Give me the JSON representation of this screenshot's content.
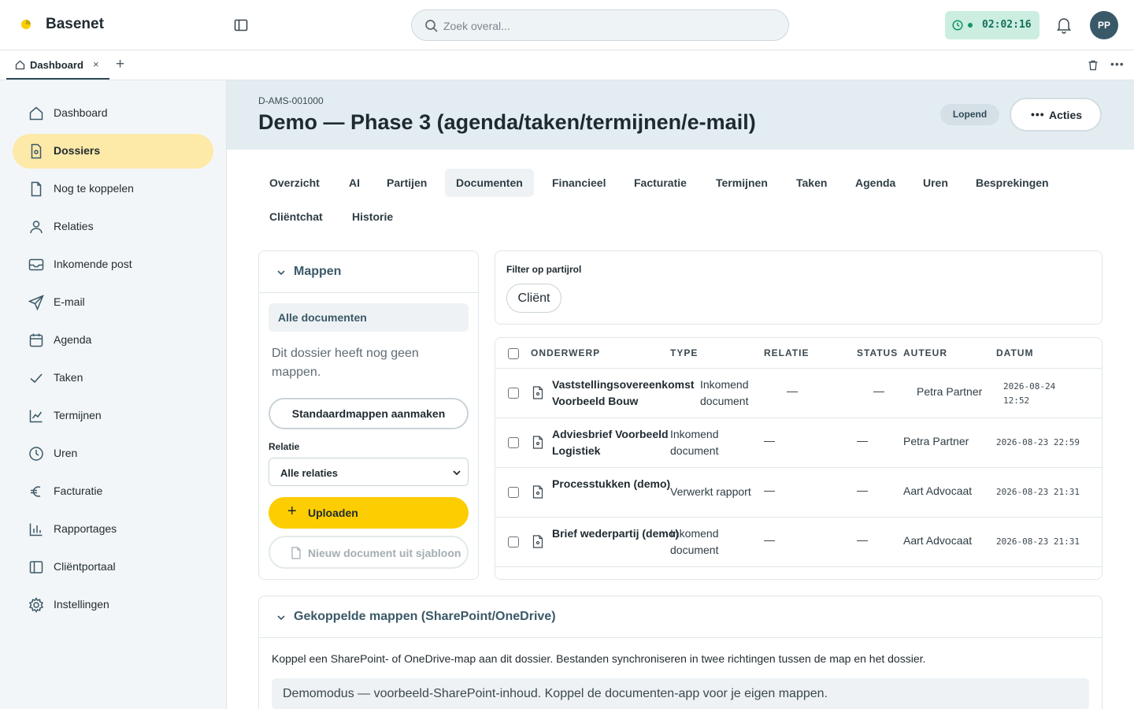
{
  "app": {
    "brand": "Basenet",
    "search_placeholder": "Zoek overal...",
    "timer": "02:02:16",
    "avatar_initials": "PP",
    "colors": {
      "accent_yellow": "#fccd00",
      "sidebar_active": "#fde9a8",
      "timer_bg": "#cbeee0",
      "header_bg": "#e3edf1"
    }
  },
  "tabs": [
    {
      "label": "Dashboard",
      "close": "×",
      "icon": "home-icon"
    }
  ],
  "tabbar": {
    "add": "+",
    "more": "•••"
  },
  "sidebar": {
    "items": [
      {
        "label": "Dashboard",
        "icon": "home-icon"
      },
      {
        "label": "Dossiers",
        "icon": "file-icon",
        "active": true
      },
      {
        "label": "Nog te koppelen",
        "icon": "file-icon"
      },
      {
        "label": "Relaties",
        "icon": "user-icon"
      },
      {
        "label": "Inkomende post",
        "icon": "inbox-icon"
      },
      {
        "label": "E-mail",
        "icon": "send-icon"
      },
      {
        "label": "Agenda",
        "icon": "calendar-icon"
      },
      {
        "label": "Taken",
        "icon": "check-icon"
      },
      {
        "label": "Termijnen",
        "icon": "line-chart-icon"
      },
      {
        "label": "Uren",
        "icon": "clock-icon"
      },
      {
        "label": "Facturatie",
        "icon": "euro-icon"
      },
      {
        "label": "Rapportages",
        "icon": "bar-chart-icon"
      },
      {
        "label": "Cliëntportaal",
        "icon": "panel-icon"
      },
      {
        "label": "Instellingen",
        "icon": "gear-icon"
      }
    ]
  },
  "dossier": {
    "id": "D-AMS-001000",
    "title": "Demo — Phase 3 (agenda/taken/termijnen/e-mail)",
    "status": "Lopend",
    "actions_dots": "•••",
    "actions_label": "Acties"
  },
  "content_tabs": [
    {
      "label": "Overzicht"
    },
    {
      "label": "AI"
    },
    {
      "label": "Partijen"
    },
    {
      "label": "Documenten",
      "active": true
    },
    {
      "label": "Financieel"
    },
    {
      "label": "Facturatie"
    },
    {
      "label": "Termijnen"
    },
    {
      "label": "Taken"
    },
    {
      "label": "Agenda"
    },
    {
      "label": "Uren"
    },
    {
      "label": "Besprekingen"
    },
    {
      "label": "Cliëntchat"
    },
    {
      "label": "Historie"
    }
  ],
  "folders": {
    "title": "Mappen",
    "all_documents": "Alle documenten",
    "empty_text": "Dit dossier heeft nog geen mappen.",
    "create_default": "Standaardmappen aanmaken",
    "relation_label": "Relatie",
    "relation_value": "Alle relaties",
    "upload_plus": "+",
    "upload": "Uploaden",
    "from_template": "Nieuw document uit sjabloon"
  },
  "filter": {
    "label": "Filter op partijrol",
    "chip": "Cliënt"
  },
  "documents": {
    "columns": [
      "ONDERWERP",
      "TYPE",
      "RELATIE",
      "STATUS",
      "AUTEUR",
      "DATUM"
    ],
    "rows": [
      {
        "subject": "Vaststellingsovereenkomst Voorbeeld Bouw",
        "type": "Inkomend document",
        "relation": "—",
        "status": "—",
        "author": "Petra Partner",
        "date": "2026-08-24 12:52"
      },
      {
        "subject": "Adviesbrief Voorbeeld Logistiek",
        "type": "Inkomend document",
        "relation": "—",
        "status": "—",
        "author": "Petra Partner",
        "date": "2026-08-23 22:59"
      },
      {
        "subject": "Processtukken (demo)",
        "type": "Verwerkt rapport",
        "relation": "—",
        "status": "—",
        "author": "Aart Advocaat",
        "date": "2026-08-23 21:31"
      },
      {
        "subject": "Brief wederpartij (demo)",
        "type": "Inkomend document",
        "relation": "—",
        "status": "—",
        "author": "Aart Advocaat",
        "date": "2026-08-23 21:31"
      }
    ]
  },
  "linked_folders": {
    "title": "Gekoppelde mappen (SharePoint/OneDrive)",
    "description": "Koppel een SharePoint- of OneDrive-map aan dit dossier. Bestanden synchroniseren in twee richtingen tussen de map en het dossier.",
    "demo_notice": "Demomodus — voorbeeld-SharePoint-inhoud. Koppel de documenten-app voor je eigen mappen."
  }
}
